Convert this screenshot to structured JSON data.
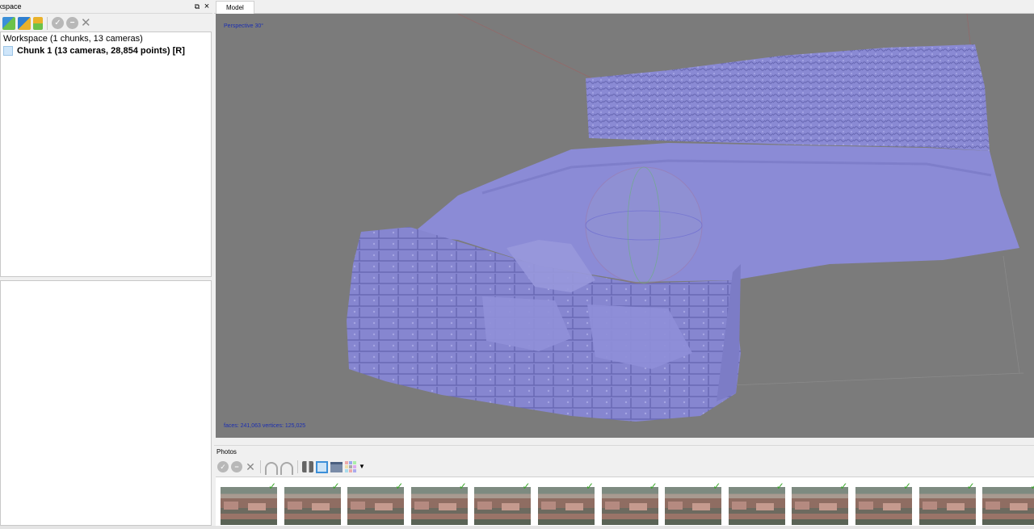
{
  "workspace_panel": {
    "title": "kspace",
    "tree": {
      "root": "Workspace (1 chunks, 13 cameras)",
      "chunk": "Chunk 1 (13 cameras, 28,854 points) [R]"
    }
  },
  "view_tabs": [
    {
      "label": "Model"
    }
  ],
  "viewport": {
    "projection_label": "Perspective 30°",
    "stats_label": "faces: 241,063 vertices: 125,025",
    "background_color": "#7b7b7b",
    "mesh_color": "#8a8ad4"
  },
  "photos_panel": {
    "title": "Photos",
    "thumbnail_count": 13,
    "aligned_marks": 13
  },
  "icons": {
    "workspace_toolbar": [
      "add-chunk-icon",
      "add-photos-icon",
      "add-markers-icon",
      "enable-icon",
      "disable-icon",
      "remove-icon"
    ],
    "photos_toolbar": [
      "enable-icon",
      "disable-icon",
      "remove-icon",
      "rotate-left-icon",
      "rotate-right-icon",
      "binoculars-icon",
      "select-icon",
      "view-icon",
      "grid-icon",
      "dropdown-arrow-icon"
    ]
  }
}
